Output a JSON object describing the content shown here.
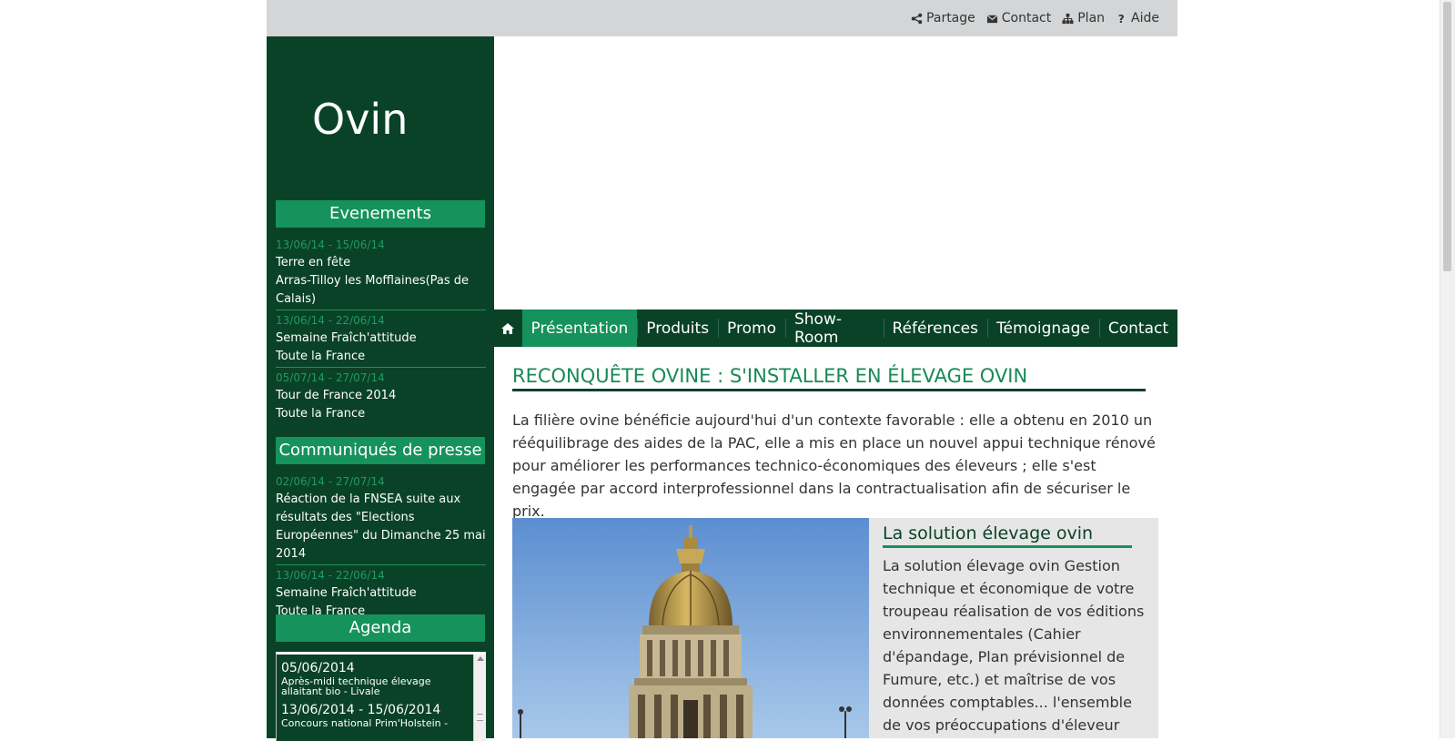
{
  "toplinks": [
    {
      "label": "Partage",
      "icon": "share-icon"
    },
    {
      "label": "Contact",
      "icon": "envelope-icon"
    },
    {
      "label": "Plan",
      "icon": "sitemap-icon"
    },
    {
      "label": "Aide",
      "icon": "question-icon"
    }
  ],
  "site": {
    "title": "Ovin"
  },
  "sidebar": {
    "events_heading": "Evenements",
    "events": [
      {
        "date": "13/06/14 - 15/06/14",
        "line1": "Terre en fête",
        "line2": "Arras-Tilloy les Mofflaines(Pas de Calais)"
      },
      {
        "date": "13/06/14 - 22/06/14",
        "line1": "Semaine Fraîch'attitude",
        "line2": "Toute la France"
      },
      {
        "date": "05/07/14 - 27/07/14",
        "line1": "Tour de France 2014",
        "line2": "Toute la France"
      }
    ],
    "press_heading": "Communiqués de presse",
    "press": [
      {
        "date": "02/06/14 - 27/07/14",
        "line1": "Réaction de la FNSEA suite aux résultats des \"Elections Européennes\" du Dimanche 25 mai 2014",
        "line2": ""
      },
      {
        "date": "13/06/14 - 22/06/14",
        "line1": "Semaine Fraîch'attitude",
        "line2": "Toute la France"
      }
    ],
    "agenda_heading": "Agenda",
    "agenda": [
      {
        "date": "05/06/2014",
        "text": "Après-midi technique élevage allaitant bio - Livale"
      },
      {
        "date": "13/06/2014 - 15/06/2014",
        "text": "Concours national Prim'Holstein -"
      }
    ]
  },
  "nav": {
    "home_icon": "home-icon",
    "items": [
      "Présentation",
      "Produits",
      "Promo",
      "Show-Room",
      "Références",
      "Témoignage",
      "Contact"
    ],
    "active": "Présentation"
  },
  "main": {
    "title": "RECONQUÊTE OVINE : S'INSTALLER EN ÉLEVAGE OVIN",
    "intro": "La filière ovine bénéficie aujourd'hui d'un contexte favorable : elle a obtenu en 2010 un rééquilibrage des aides de la PAC, elle a mis en place un nouvel appui technique rénové pour améliorer les performances technico-économiques des éleveurs ; elle s'est engagée par accord interprofessionnel dans la contractualisation afin de sécuriser le prix.",
    "solution": {
      "title": "La solution élevage ovin",
      "text": "La solution élevage ovin Gestion technique et économique de votre troupeau réalisation de vos éditions environnementales (Cahier d'épandage, Plan prévisionnel de Fumure, etc.) et maîtrise de vos données comptables... l'ensemble de vos préoccupations d'éleveur"
    }
  },
  "colors": {
    "dark_green": "#0a4227",
    "accent_green": "#16925c",
    "topbar_gray": "#d4d5d6"
  }
}
